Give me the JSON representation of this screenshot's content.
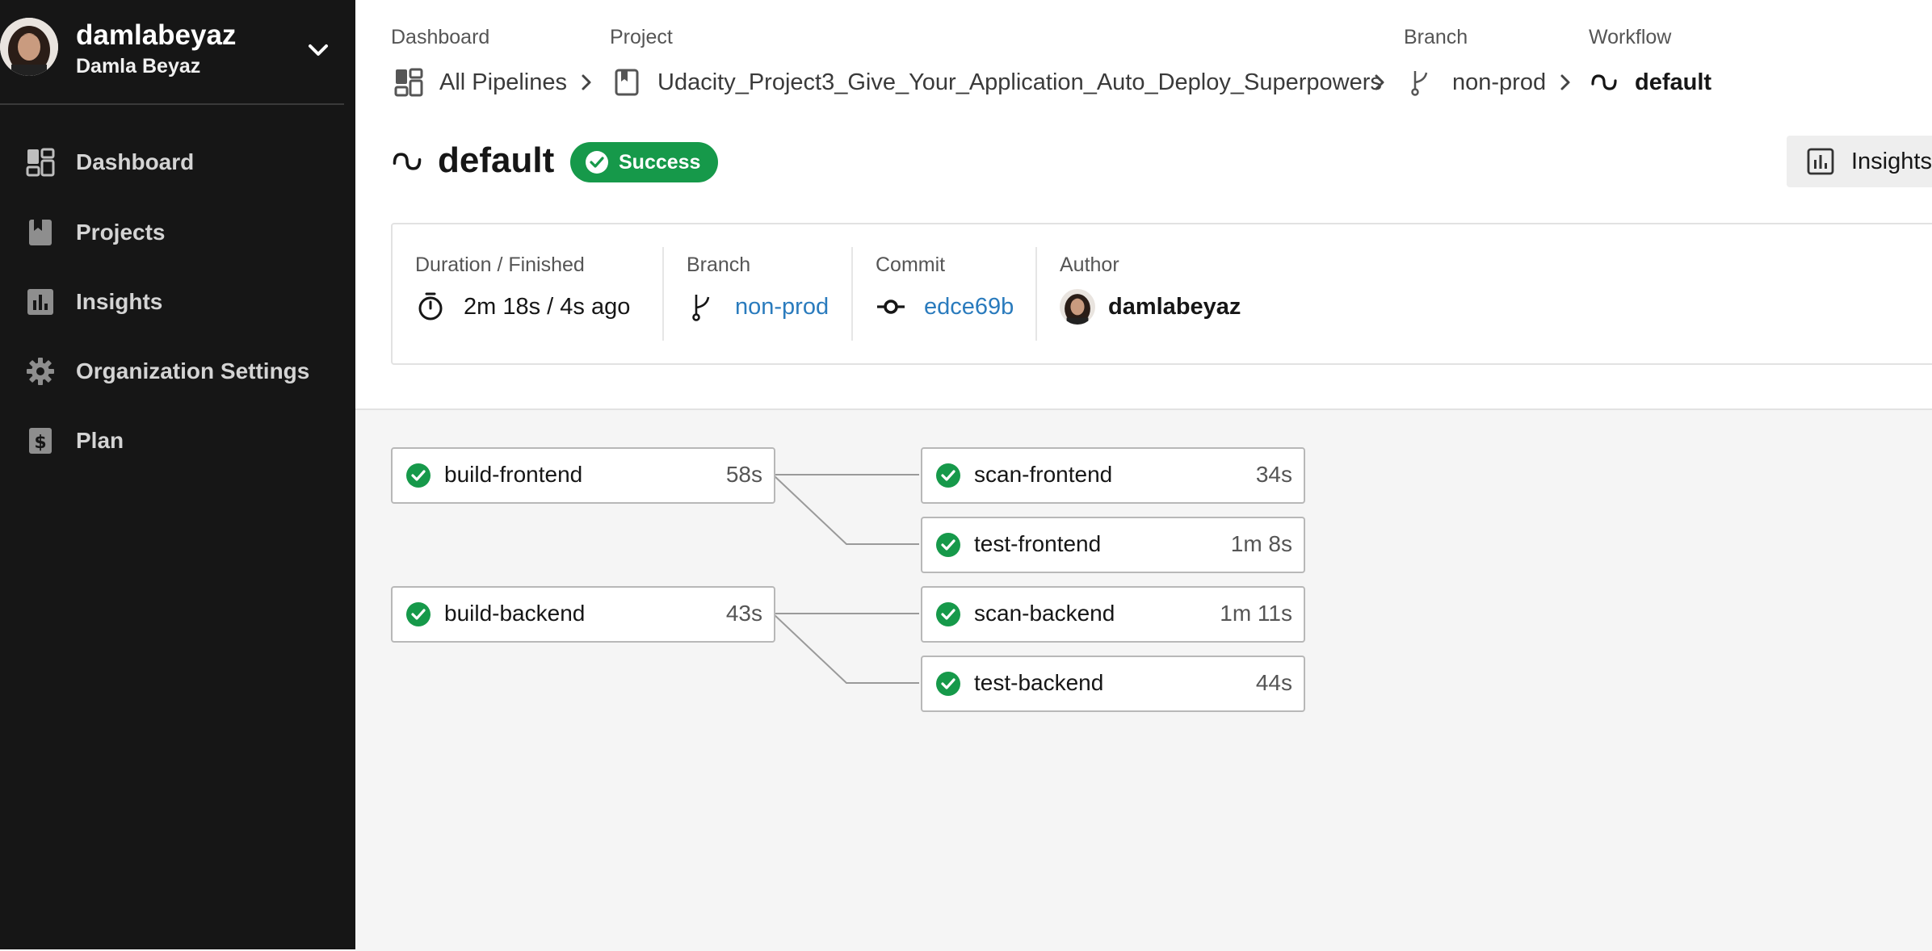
{
  "sidebar": {
    "user": {
      "username": "damlabeyaz",
      "full_name": "Damla Beyaz"
    },
    "items": [
      {
        "label": "Dashboard",
        "icon": "dashboard-icon"
      },
      {
        "label": "Projects",
        "icon": "projects-icon"
      },
      {
        "label": "Insights",
        "icon": "insights-icon"
      },
      {
        "label": "Organization Settings",
        "icon": "gear-icon"
      },
      {
        "label": "Plan",
        "icon": "plan-icon"
      }
    ]
  },
  "breadcrumb": {
    "dashboard": {
      "label": "Dashboard",
      "value": "All Pipelines"
    },
    "project": {
      "label": "Project",
      "value": "Udacity_Project3_Give_Your_Application_Auto_Deploy_Superpowers"
    },
    "branch": {
      "label": "Branch",
      "value": "non-prod"
    },
    "workflow": {
      "label": "Workflow",
      "value": "default"
    }
  },
  "header": {
    "title": "default",
    "status": "Success",
    "insights_label": "Insights"
  },
  "summary": {
    "duration": {
      "label": "Duration / Finished",
      "value": "2m 18s / 4s ago"
    },
    "branch": {
      "label": "Branch",
      "value": "non-prod"
    },
    "commit": {
      "label": "Commit",
      "value": "edce69b"
    },
    "author": {
      "label": "Author",
      "value": "damlabeyaz"
    }
  },
  "jobs": [
    {
      "name": "build-frontend",
      "duration": "58s",
      "status": "success"
    },
    {
      "name": "scan-frontend",
      "duration": "34s",
      "status": "success"
    },
    {
      "name": "test-frontend",
      "duration": "1m 8s",
      "status": "success"
    },
    {
      "name": "build-backend",
      "duration": "43s",
      "status": "success"
    },
    {
      "name": "scan-backend",
      "duration": "1m 11s",
      "status": "success"
    },
    {
      "name": "test-backend",
      "duration": "44s",
      "status": "success"
    }
  ],
  "colors": {
    "sidebar_bg": "#161616",
    "success": "#16994a",
    "link": "#2a7bbd",
    "graph_bg": "#f5f5f5"
  }
}
